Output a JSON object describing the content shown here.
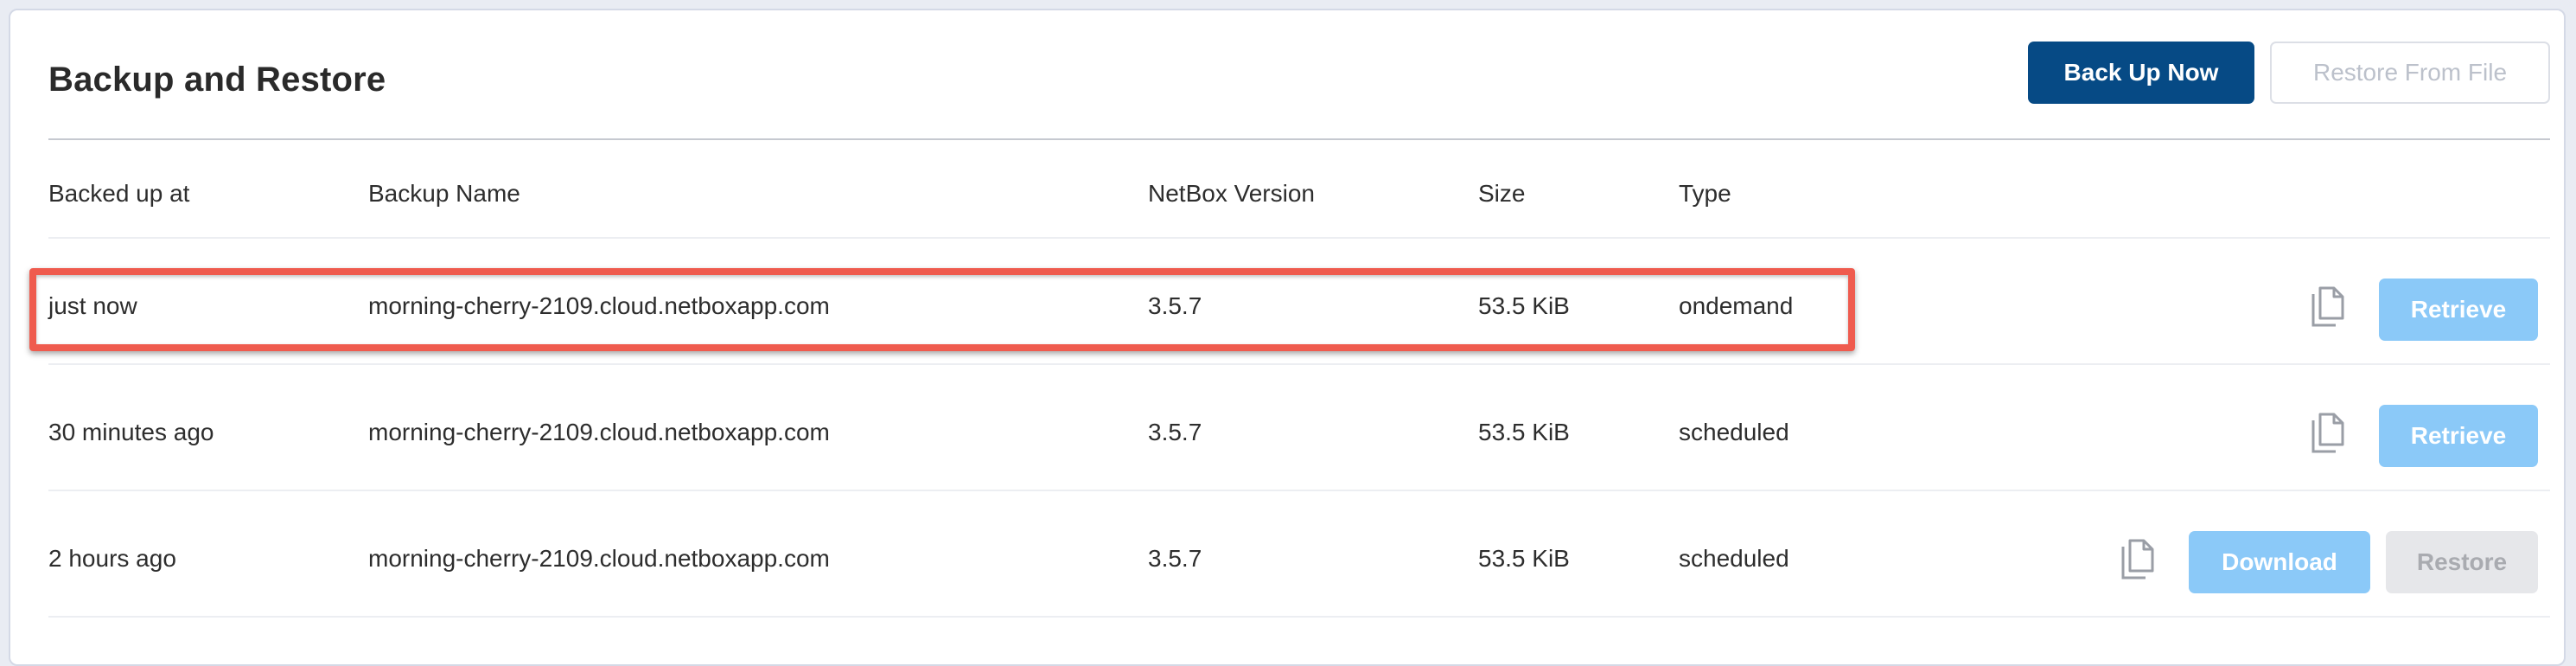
{
  "page": {
    "title": "Backup and Restore",
    "back_up_now_label": "Back Up Now",
    "restore_from_file_label": "Restore From File"
  },
  "table": {
    "headers": [
      "Backed up at",
      "Backup Name",
      "NetBox Version",
      "Size",
      "Type"
    ],
    "rows": [
      {
        "backed_up_at": "just now",
        "name": "morning-cherry-2109.cloud.netboxapp.com",
        "version": "3.5.7",
        "size": "53.5 KiB",
        "type": "ondemand",
        "actions": [
          "Retrieve"
        ]
      },
      {
        "backed_up_at": "30 minutes ago",
        "name": "morning-cherry-2109.cloud.netboxapp.com",
        "version": "3.5.7",
        "size": "53.5 KiB",
        "type": "scheduled",
        "actions": [
          "Retrieve"
        ]
      },
      {
        "backed_up_at": "2 hours ago",
        "name": "morning-cherry-2109.cloud.netboxapp.com",
        "version": "3.5.7",
        "size": "53.5 KiB",
        "type": "scheduled",
        "actions": [
          "Download",
          "Restore"
        ]
      }
    ]
  },
  "icons": {
    "copy": "copy-icon"
  },
  "colors": {
    "primary": "#064a85",
    "light_button": "#8bc9f8",
    "disabled_button": "#e6e7ea",
    "highlight": "#ef5b4e"
  }
}
